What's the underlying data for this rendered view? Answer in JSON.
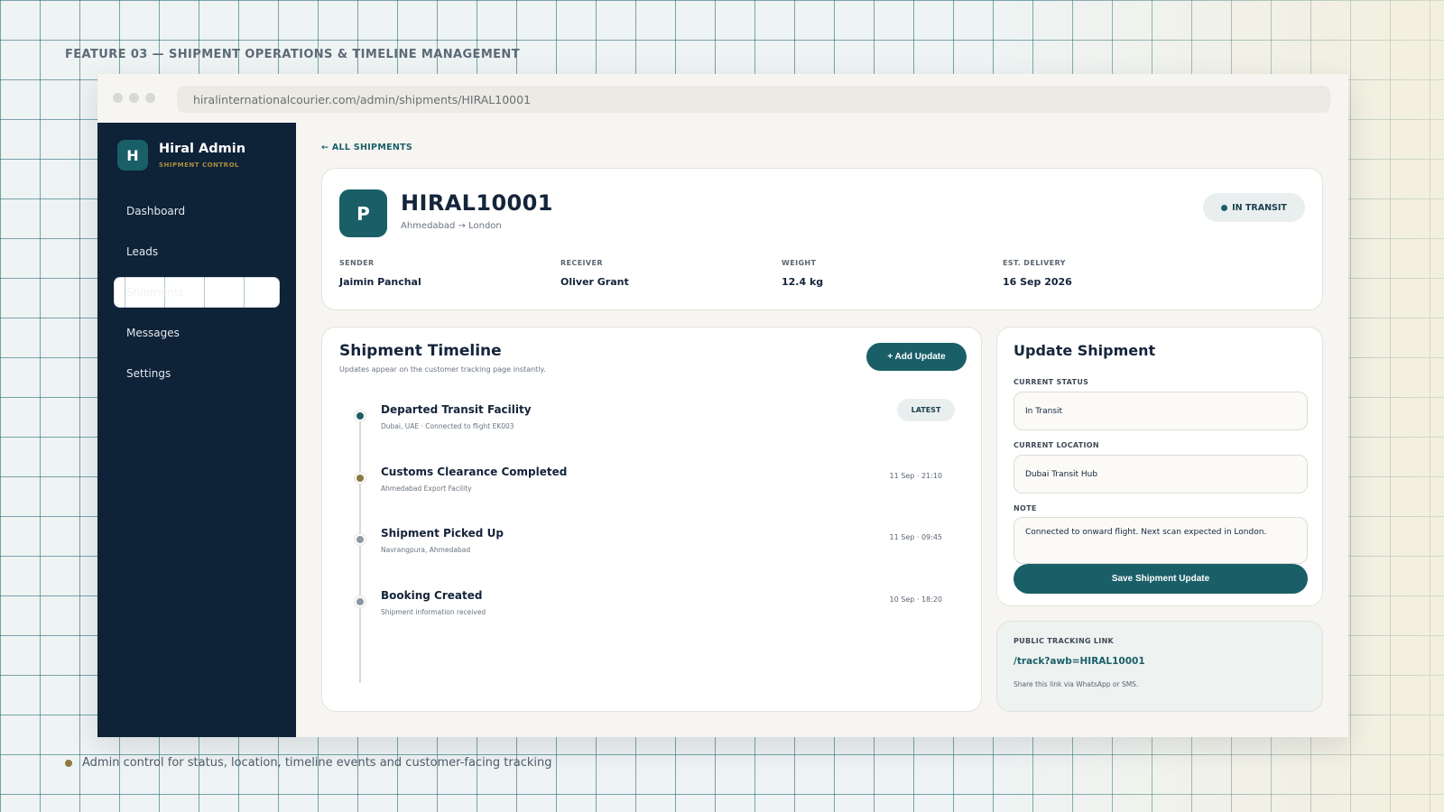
{
  "feature_heading": "FEATURE 03 — SHIPMENT OPERATIONS & TIMELINE MANAGEMENT",
  "browser": {
    "url": "hiralinternationalcourier.com/admin/shipments/HIRAL10001"
  },
  "sidebar": {
    "brand_initial": "H",
    "brand_name": "Hiral Admin",
    "brand_subtitle": "SHIPMENT CONTROL",
    "items": [
      {
        "label": "Dashboard",
        "active": false
      },
      {
        "label": "Leads",
        "active": false
      },
      {
        "label": "Shipments",
        "active": true
      },
      {
        "label": "Messages",
        "active": false
      },
      {
        "label": "Settings",
        "active": false
      }
    ]
  },
  "back_link": "← ALL SHIPMENTS",
  "shipment": {
    "avatar_initial": "P",
    "id": "HIRAL10001",
    "route": "Ahmedabad → London",
    "status": "IN TRANSIT",
    "meta": [
      {
        "label": "SENDER",
        "value": "Jaimin Panchal"
      },
      {
        "label": "RECEIVER",
        "value": "Oliver Grant"
      },
      {
        "label": "WEIGHT",
        "value": "12.4 kg"
      },
      {
        "label": "EST. DELIVERY",
        "value": "16 Sep 2026"
      }
    ]
  },
  "timeline": {
    "title": "Shipment Timeline",
    "subtitle": "Updates appear on the customer tracking page instantly.",
    "add_button": "+ Add Update",
    "events": [
      {
        "title": "Departed Transit Facility",
        "detail": "Dubai, UAE · Connected to flight EK003",
        "time": "",
        "badge": "LATEST",
        "dot_color": "#1a5f68"
      },
      {
        "title": "Customs Clearance Completed",
        "detail": "Ahmedabad Export Facility",
        "time": "11 Sep · 21:10",
        "badge": "",
        "dot_color": "#8a7a3e"
      },
      {
        "title": "Shipment Picked Up",
        "detail": "Navrangpura, Ahmedabad",
        "time": "11 Sep · 09:45",
        "badge": "",
        "dot_color": "#8c97a3"
      },
      {
        "title": "Booking Created",
        "detail": "Shipment information received",
        "time": "10 Sep · 18:20",
        "badge": "",
        "dot_color": "#8c97a3"
      }
    ]
  },
  "update_form": {
    "title": "Update Shipment",
    "status_label": "CURRENT STATUS",
    "status_value": "In Transit",
    "location_label": "CURRENT LOCATION",
    "location_value": "Dubai Transit Hub",
    "note_label": "NOTE",
    "note_value": "Connected to onward flight. Next scan expected in London.",
    "save_button": "Save Shipment Update"
  },
  "tracking": {
    "label": "PUBLIC TRACKING LINK",
    "link": "/track?awb=HIRAL10001",
    "note": "Share this link via WhatsApp or SMS."
  },
  "caption": "Admin control for status, location, timeline events and customer-facing tracking",
  "colors": {
    "accent": "#1a5f68",
    "sidebar_bg": "#0e2238",
    "gold": "#8a7a3e"
  }
}
